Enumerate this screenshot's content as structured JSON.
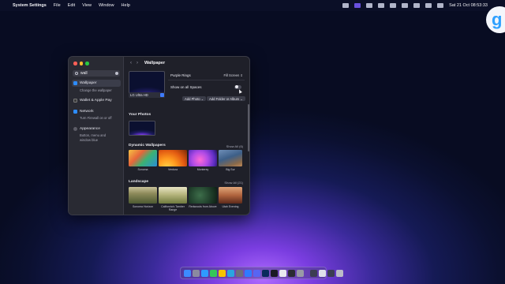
{
  "menubar": {
    "apple": "",
    "app_name": "System Settings",
    "menus": [
      "File",
      "Edit",
      "View",
      "Window",
      "Help"
    ],
    "clock": "Sat 21 Oct  08:53:33"
  },
  "corner_badge": "g",
  "window": {
    "search": {
      "value": "wall"
    },
    "sidebar": [
      {
        "label": "Wallpaper",
        "sub": "Change the wallpaper",
        "icon": "wallpaper-icon",
        "color": "#2d8cff",
        "selected": true
      },
      {
        "label": "Wallet & Apple Pay",
        "sub": "",
        "icon": "wallet-icon",
        "color": "#3b3b3b",
        "selected": false
      },
      {
        "label": "Network",
        "sub": "Turn Firewall on or off",
        "icon": "network-icon",
        "color": "#2d8cff",
        "selected": false
      },
      {
        "label": "Appearance",
        "sub": "Button, menu and window blue",
        "icon": "appearance-icon",
        "color": "#5c5c66",
        "selected": false
      }
    ],
    "title": "Wallpaper",
    "current": {
      "preview_label": "LG Ultra HD",
      "name": "Purple Rings",
      "fill": "Fill Screen",
      "show_all_spaces": "Show on all Spaces",
      "toggle_on": false,
      "add_photo": "Add Photo",
      "add_folder": "Add Folder or Album"
    },
    "your_photos": "Your Photos",
    "dynamic": {
      "title": "Dynamic Wallpapers",
      "show_all": "Show All (6)",
      "items": [
        "Sonoma",
        "Ventura",
        "Monterey",
        "Big Sur"
      ]
    },
    "landscape": {
      "title": "Landscape",
      "show_all": "Show All (21)",
      "items": [
        "Sonoma Horizon",
        "California's Tamber Range",
        "Redwoods from Above",
        "Utah Evening"
      ]
    }
  },
  "dock_apps": [
    {
      "name": "finder-app",
      "color": "#3d8bff"
    },
    {
      "name": "launchpad-app",
      "color": "#8a8aa0"
    },
    {
      "name": "safari-app",
      "color": "#2f9bff"
    },
    {
      "name": "messages-app",
      "color": "#35c759"
    },
    {
      "name": "notes-app",
      "color": "#f5c400"
    },
    {
      "name": "telegram-app",
      "color": "#2aa5e0"
    },
    {
      "name": "finalcut-app",
      "color": "#6e6e7a"
    },
    {
      "name": "mail-app",
      "color": "#2f7bff"
    },
    {
      "name": "discord-app",
      "color": "#5865f2"
    },
    {
      "name": "photoshop-app",
      "color": "#0a2a5c"
    },
    {
      "name": "app-11",
      "color": "#1a1a24"
    },
    {
      "name": "chrome-app",
      "color": "#e9e9ef"
    },
    {
      "name": "terminal-app",
      "color": "#2b2b33"
    },
    {
      "name": "settings-app",
      "color": "#9a9aa6"
    }
  ],
  "dock_tail": [
    {
      "name": "minimized-window-1",
      "color": "#3b3d52"
    },
    {
      "name": "minimized-window-2",
      "color": "#e0e0ea"
    },
    {
      "name": "minimized-window-3",
      "color": "#3b3d52"
    },
    {
      "name": "trash-app",
      "color": "#bcbcc8"
    }
  ]
}
